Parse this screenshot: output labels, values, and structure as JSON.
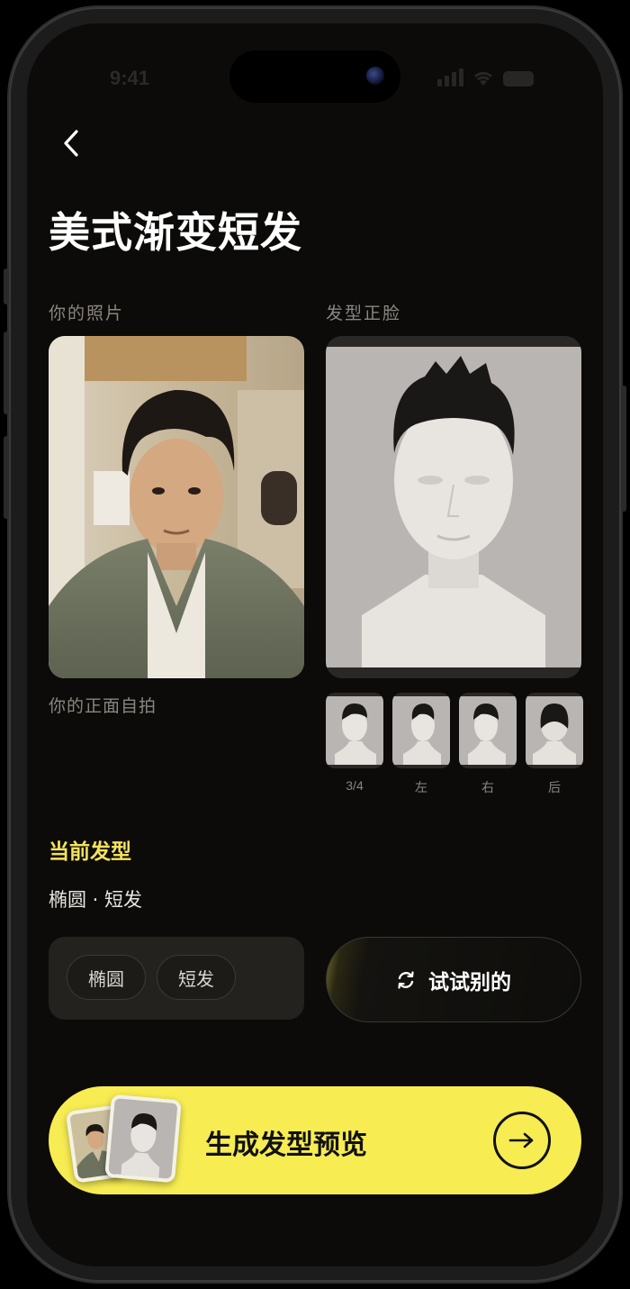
{
  "status_bar": {
    "time": "9:41"
  },
  "header": {
    "title": "美式渐变短发"
  },
  "your_photo": {
    "label": "你的照片",
    "caption": "你的正面自拍"
  },
  "hairstyle_front": {
    "label": "发型正脸"
  },
  "angle_thumbnails": [
    {
      "label": "3/4"
    },
    {
      "label": "左"
    },
    {
      "label": "右"
    },
    {
      "label": "后"
    }
  ],
  "current_style": {
    "section_title": "当前发型",
    "summary": "椭圆 · 短发",
    "tags": [
      "椭圆",
      "短发"
    ]
  },
  "try_other_button": {
    "label": "试试别的"
  },
  "generate_button": {
    "label": "生成发型预览"
  },
  "colors": {
    "accent_yellow": "#f7ec52",
    "section_yellow": "#f4e35a",
    "background": "#0c0b09"
  }
}
